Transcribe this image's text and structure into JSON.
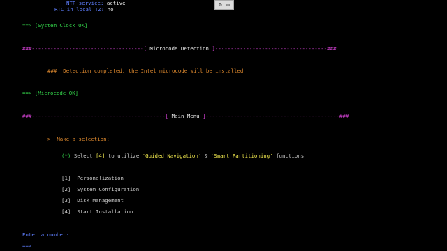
{
  "toolbar": {
    "icons": [
      "settings-icon",
      "keyboard-icon"
    ]
  },
  "status": {
    "ntp_label": "NTP service:",
    "ntp_value": "active",
    "rtc_label": "RTC in local TZ:",
    "rtc_value": "no"
  },
  "clock_ok": "==> [System Clock OK]",
  "microcode_header": {
    "left": "###------------------------------------[",
    "title": " Microcode Detection ",
    "right": "]------------------------------------###"
  },
  "microcode_msg": "###  Detection completed, the Intel microcode will be installed",
  "microcode_ok": "==> [Microcode OK]",
  "menu_header": {
    "left": "###-------------------------------------------[",
    "title": " Main Menu ",
    "right": "]-------------------------------------------###"
  },
  "prompt_select": ">  Make a selection:",
  "guided": {
    "marker": "(*)",
    "select": "Select",
    "num": "[4]",
    "to_utilize": "to utilize",
    "guided_nav": "'Guided Navigation'",
    "amp": "&",
    "smart": "'Smart Partitioning'",
    "functions": "functions"
  },
  "menu_items": [
    {
      "num": "[1]",
      "label": "Personalization"
    },
    {
      "num": "[2]",
      "label": "System Configuration"
    },
    {
      "num": "[3]",
      "label": "Disk Management"
    },
    {
      "num": "[4]",
      "label": "Start Installation"
    }
  ],
  "enter_number": "Enter a number:",
  "input_prompt": "==>"
}
